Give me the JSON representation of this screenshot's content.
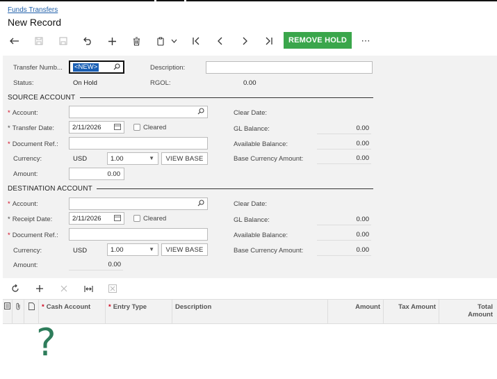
{
  "breadcrumb": "Funds Transfers",
  "page_title": "New Record",
  "toolbar": {
    "remove_hold_label": "REMOVE HOLD",
    "more_label": "⋯",
    "accent_color": "#3aa64b"
  },
  "header_fields": {
    "transfer_number_label": "Transfer Numb...",
    "transfer_number_value": "<NEW>",
    "description_label": "Description:",
    "description_value": "",
    "status_label": "Status:",
    "status_value": "On Hold",
    "rgol_label": "RGOL:",
    "rgol_value": "0.00"
  },
  "source": {
    "section_title": "SOURCE ACCOUNT",
    "account_label": "Account:",
    "account_value": "",
    "date_label": "Transfer Date:",
    "date_value": "2/11/2026",
    "cleared_label": "Cleared",
    "docref_label": "Document Ref.:",
    "docref_value": "",
    "currency_label": "Currency:",
    "currency_value": "USD",
    "rate_value": "1.00",
    "view_base_label": "VIEW BASE",
    "amount_label": "Amount:",
    "amount_value": "0.00",
    "clear_date_label": "Clear Date:",
    "clear_date_value": "",
    "gl_balance_label": "GL Balance:",
    "gl_balance_value": "0.00",
    "available_balance_label": "Available Balance:",
    "available_balance_value": "0.00",
    "base_currency_amount_label": "Base Currency Amount:",
    "base_currency_amount_value": "0.00"
  },
  "destination": {
    "section_title": "DESTINATION ACCOUNT",
    "account_label": "Account:",
    "account_value": "",
    "date_label": "Receipt Date:",
    "date_value": "2/11/2026",
    "cleared_label": "Cleared",
    "docref_label": "Document Ref.:",
    "docref_value": "",
    "currency_label": "Currency:",
    "currency_value": "USD",
    "rate_value": "1.00",
    "view_base_label": "VIEW BASE",
    "amount_label": "Amount:",
    "amount_value": "0.00",
    "clear_date_label": "Clear Date:",
    "clear_date_value": "",
    "gl_balance_label": "GL Balance:",
    "gl_balance_value": "0.00",
    "available_balance_label": "Available Balance:",
    "available_balance_value": "0.00",
    "base_currency_amount_label": "Base Currency Amount:",
    "base_currency_amount_value": "0.00"
  },
  "grid": {
    "columns": {
      "cash_account": "Cash Account",
      "entry_type": "Entry Type",
      "description": "Description",
      "amount": "Amount",
      "tax_amount": "Tax Amount",
      "total_amount_line1": "Total",
      "total_amount_line2": "Amount"
    },
    "required_marker": "*",
    "placeholder_glyph": "?"
  }
}
